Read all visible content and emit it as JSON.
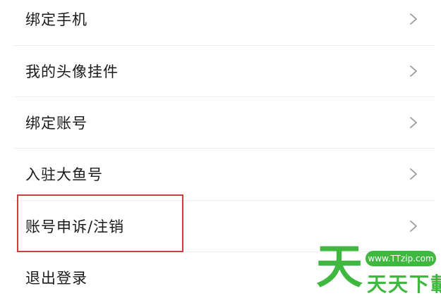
{
  "menu": {
    "items": [
      {
        "label": "绑定手机"
      },
      {
        "label": "我的头像挂件"
      },
      {
        "label": "绑定账号"
      },
      {
        "label": "入驻大鱼号"
      },
      {
        "label": "账号申诉/注销"
      },
      {
        "label": "退出登录"
      }
    ]
  },
  "watermark": {
    "big_char": "天",
    "url": "www.TTzip.com",
    "text": "天天下載"
  },
  "colors": {
    "highlight": "#c9413a",
    "watermark_green": "#3fb83f",
    "divider": "#eeeeee"
  }
}
